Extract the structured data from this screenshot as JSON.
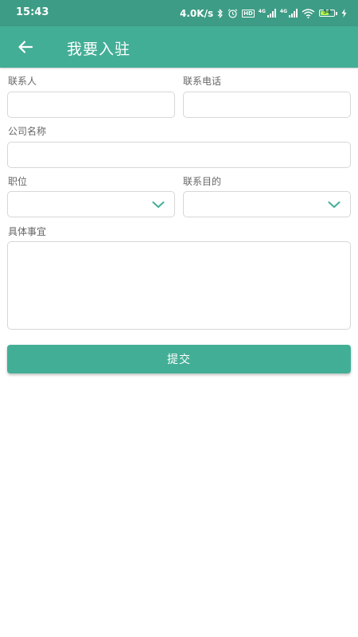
{
  "status": {
    "time": "15:43",
    "speed": "4.0K/s",
    "battery": "54",
    "sig1_label": "4G",
    "sig2_label": "4G",
    "hd_label": "HD"
  },
  "appbar": {
    "title": "我要入驻"
  },
  "form": {
    "contact_person_label": "联系人",
    "contact_phone_label": "联系电话",
    "company_name_label": "公司名称",
    "position_label": "职位",
    "purpose_label": "联系目的",
    "details_label": "具体事宜",
    "contact_person_value": "",
    "contact_phone_value": "",
    "company_name_value": "",
    "position_value": "",
    "purpose_value": "",
    "details_value": ""
  },
  "submit_label": "提交",
  "colors": {
    "primary": "#43ae96",
    "status_bar": "#3d9c85",
    "border": "#d7d7d7"
  }
}
